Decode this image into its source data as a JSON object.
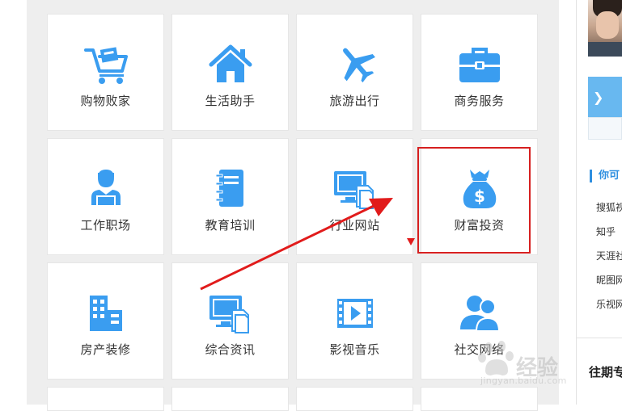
{
  "colors": {
    "icon_blue": "#3a9df0",
    "accent_red": "#d62020",
    "panel_bg": "#eeeeee",
    "sidebar_accent": "#2f8fe0"
  },
  "tiles": [
    {
      "label": "购物败家",
      "icon": "shopping-cart-icon"
    },
    {
      "label": "生活助手",
      "icon": "house-icon"
    },
    {
      "label": "旅游出行",
      "icon": "airplane-icon"
    },
    {
      "label": "商务服务",
      "icon": "briefcase-icon"
    },
    {
      "label": "工作职场",
      "icon": "office-worker-icon"
    },
    {
      "label": "教育培训",
      "icon": "notebook-icon"
    },
    {
      "label": "行业网站",
      "icon": "monitor-documents-icon"
    },
    {
      "label": "财富投资",
      "icon": "money-bag-icon"
    },
    {
      "label": "房产装修",
      "icon": "buildings-icon"
    },
    {
      "label": "综合资讯",
      "icon": "monitor-documents-icon"
    },
    {
      "label": "影视音乐",
      "icon": "film-strip-icon"
    },
    {
      "label": "社交网络",
      "icon": "people-icon"
    }
  ],
  "annotation": {
    "highlighted_tile": "财富投资",
    "arrow": "red arrow pointing to highlighted tile"
  },
  "sidebar": {
    "section_title": "你可",
    "links": [
      "搜狐视",
      "知乎",
      "天涯社",
      "昵图网",
      "乐视网"
    ],
    "past_title": "往期专"
  },
  "watermark": {
    "text": "经验",
    "url": "jingyan.baidu.com"
  }
}
